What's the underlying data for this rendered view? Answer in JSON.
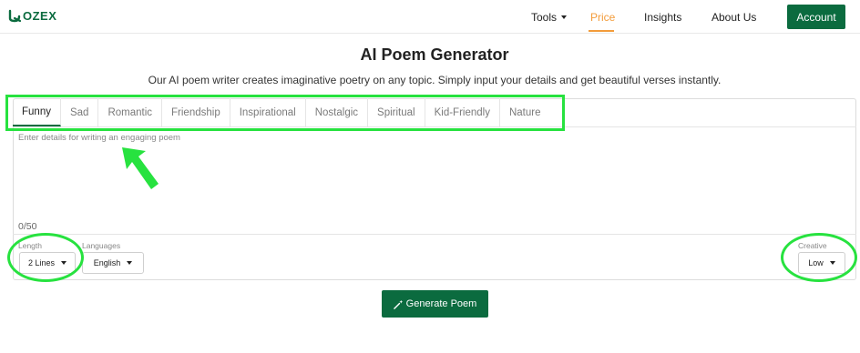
{
  "navbar": {
    "logo_text": "ozex",
    "items": [
      {
        "label": "Tools"
      },
      {
        "label": "Price"
      },
      {
        "label": "Insights"
      },
      {
        "label": "About Us"
      }
    ],
    "account_label": "Account"
  },
  "header": {
    "title": "AI Poem Generator",
    "subtitle": "Our AI poem writer creates imaginative poetry on any topic. Simply input your details and get beautiful verses instantly."
  },
  "tabs": [
    {
      "label": "Funny",
      "active": true
    },
    {
      "label": "Sad"
    },
    {
      "label": "Romantic"
    },
    {
      "label": "Friendship"
    },
    {
      "label": "Inspirational"
    },
    {
      "label": "Nostalgic"
    },
    {
      "label": "Spiritual"
    },
    {
      "label": "Kid-Friendly"
    },
    {
      "label": "Nature"
    }
  ],
  "prompt": {
    "placeholder": "Enter details for writing an engaging poem",
    "value": "",
    "char_count": "0/50"
  },
  "options": {
    "length": {
      "label": "Length",
      "value": "2 Lines"
    },
    "languages": {
      "label": "Languages",
      "value": "English"
    },
    "creative": {
      "label": "Creative",
      "value": "Low"
    }
  },
  "generate_label": "Generate Poem",
  "colors": {
    "brand_green": "#0b6b3f",
    "accent_orange": "#f39c3b",
    "annotation_green": "#27e23f"
  }
}
